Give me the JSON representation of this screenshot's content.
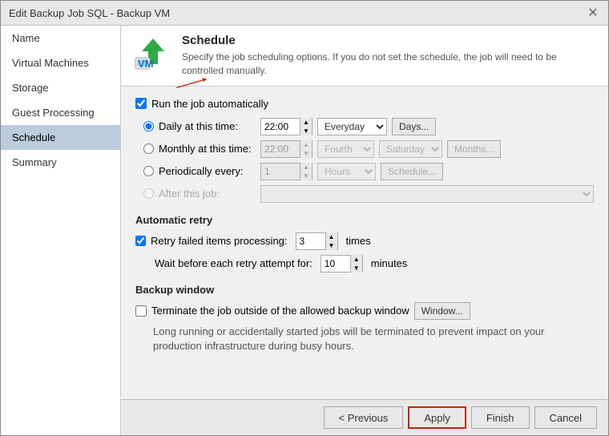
{
  "titlebar": {
    "title": "Edit Backup Job SQL - Backup VM",
    "close_label": "✕"
  },
  "sidebar": {
    "items": [
      {
        "id": "name",
        "label": "Name"
      },
      {
        "id": "virtual-machines",
        "label": "Virtual Machines"
      },
      {
        "id": "storage",
        "label": "Storage"
      },
      {
        "id": "guest-processing",
        "label": "Guest Processing"
      },
      {
        "id": "schedule",
        "label": "Schedule",
        "active": true
      },
      {
        "id": "summary",
        "label": "Summary"
      }
    ]
  },
  "header": {
    "title": "Schedule",
    "description": "Specify the job scheduling options. If you do not set the schedule, the job will need to be controlled manually."
  },
  "content": {
    "run_auto_label": "Run the job automatically",
    "daily_label": "Daily at this time:",
    "daily_time": "22:00",
    "daily_combo": "Everyday",
    "days_btn": "Days...",
    "monthly_label": "Monthly at this time:",
    "monthly_time": "22:00",
    "monthly_combo1": "Fourth",
    "monthly_combo2": "Saturday",
    "months_btn": "Months...",
    "periodic_label": "Periodically every:",
    "periodic_value": "1",
    "periodic_combo": "Hours",
    "schedule_btn": "Schedule...",
    "after_label": "After this job:",
    "auto_retry_title": "Automatic retry",
    "retry_label": "Retry failed items processing:",
    "retry_value": "3",
    "retry_unit": "times",
    "wait_label": "Wait before each retry attempt for:",
    "wait_value": "10",
    "wait_unit": "minutes",
    "backup_window_title": "Backup window",
    "terminate_label": "Terminate the job outside of the allowed backup window",
    "window_btn": "Window...",
    "long_running_desc": "Long running or accidentally started jobs will be terminated to prevent impact\non your production infrastructure during busy hours."
  },
  "footer": {
    "previous_label": "< Previous",
    "apply_label": "Apply",
    "finish_label": "Finish",
    "cancel_label": "Cancel"
  }
}
